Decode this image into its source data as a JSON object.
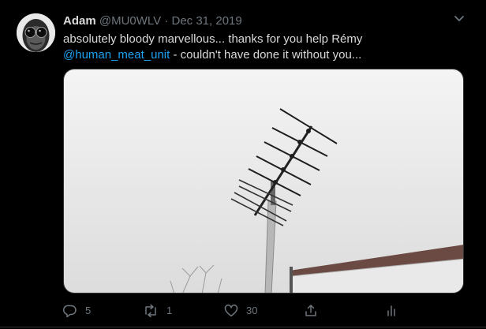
{
  "tweet": {
    "author_name": "Adam",
    "handle": "@MU0WLV",
    "separator": "·",
    "date": "Dec 31, 2019",
    "text_before": "absolutely bloody marvellous... thanks for you help Rémy",
    "mention": "@human_meat_unit",
    "text_after": " - couldn't have done it without you..."
  },
  "actions": {
    "reply_count": "5",
    "retweet_count": "1",
    "like_count": "30"
  },
  "icons": {
    "more": "chevron-down-icon",
    "reply": "reply-icon",
    "retweet": "retweet-icon",
    "like": "heart-icon",
    "share": "share-icon",
    "analytics": "analytics-icon"
  },
  "colors": {
    "background": "#000000",
    "text": "#d9d9d9",
    "muted": "#6e767d",
    "link": "#1da1f2"
  }
}
